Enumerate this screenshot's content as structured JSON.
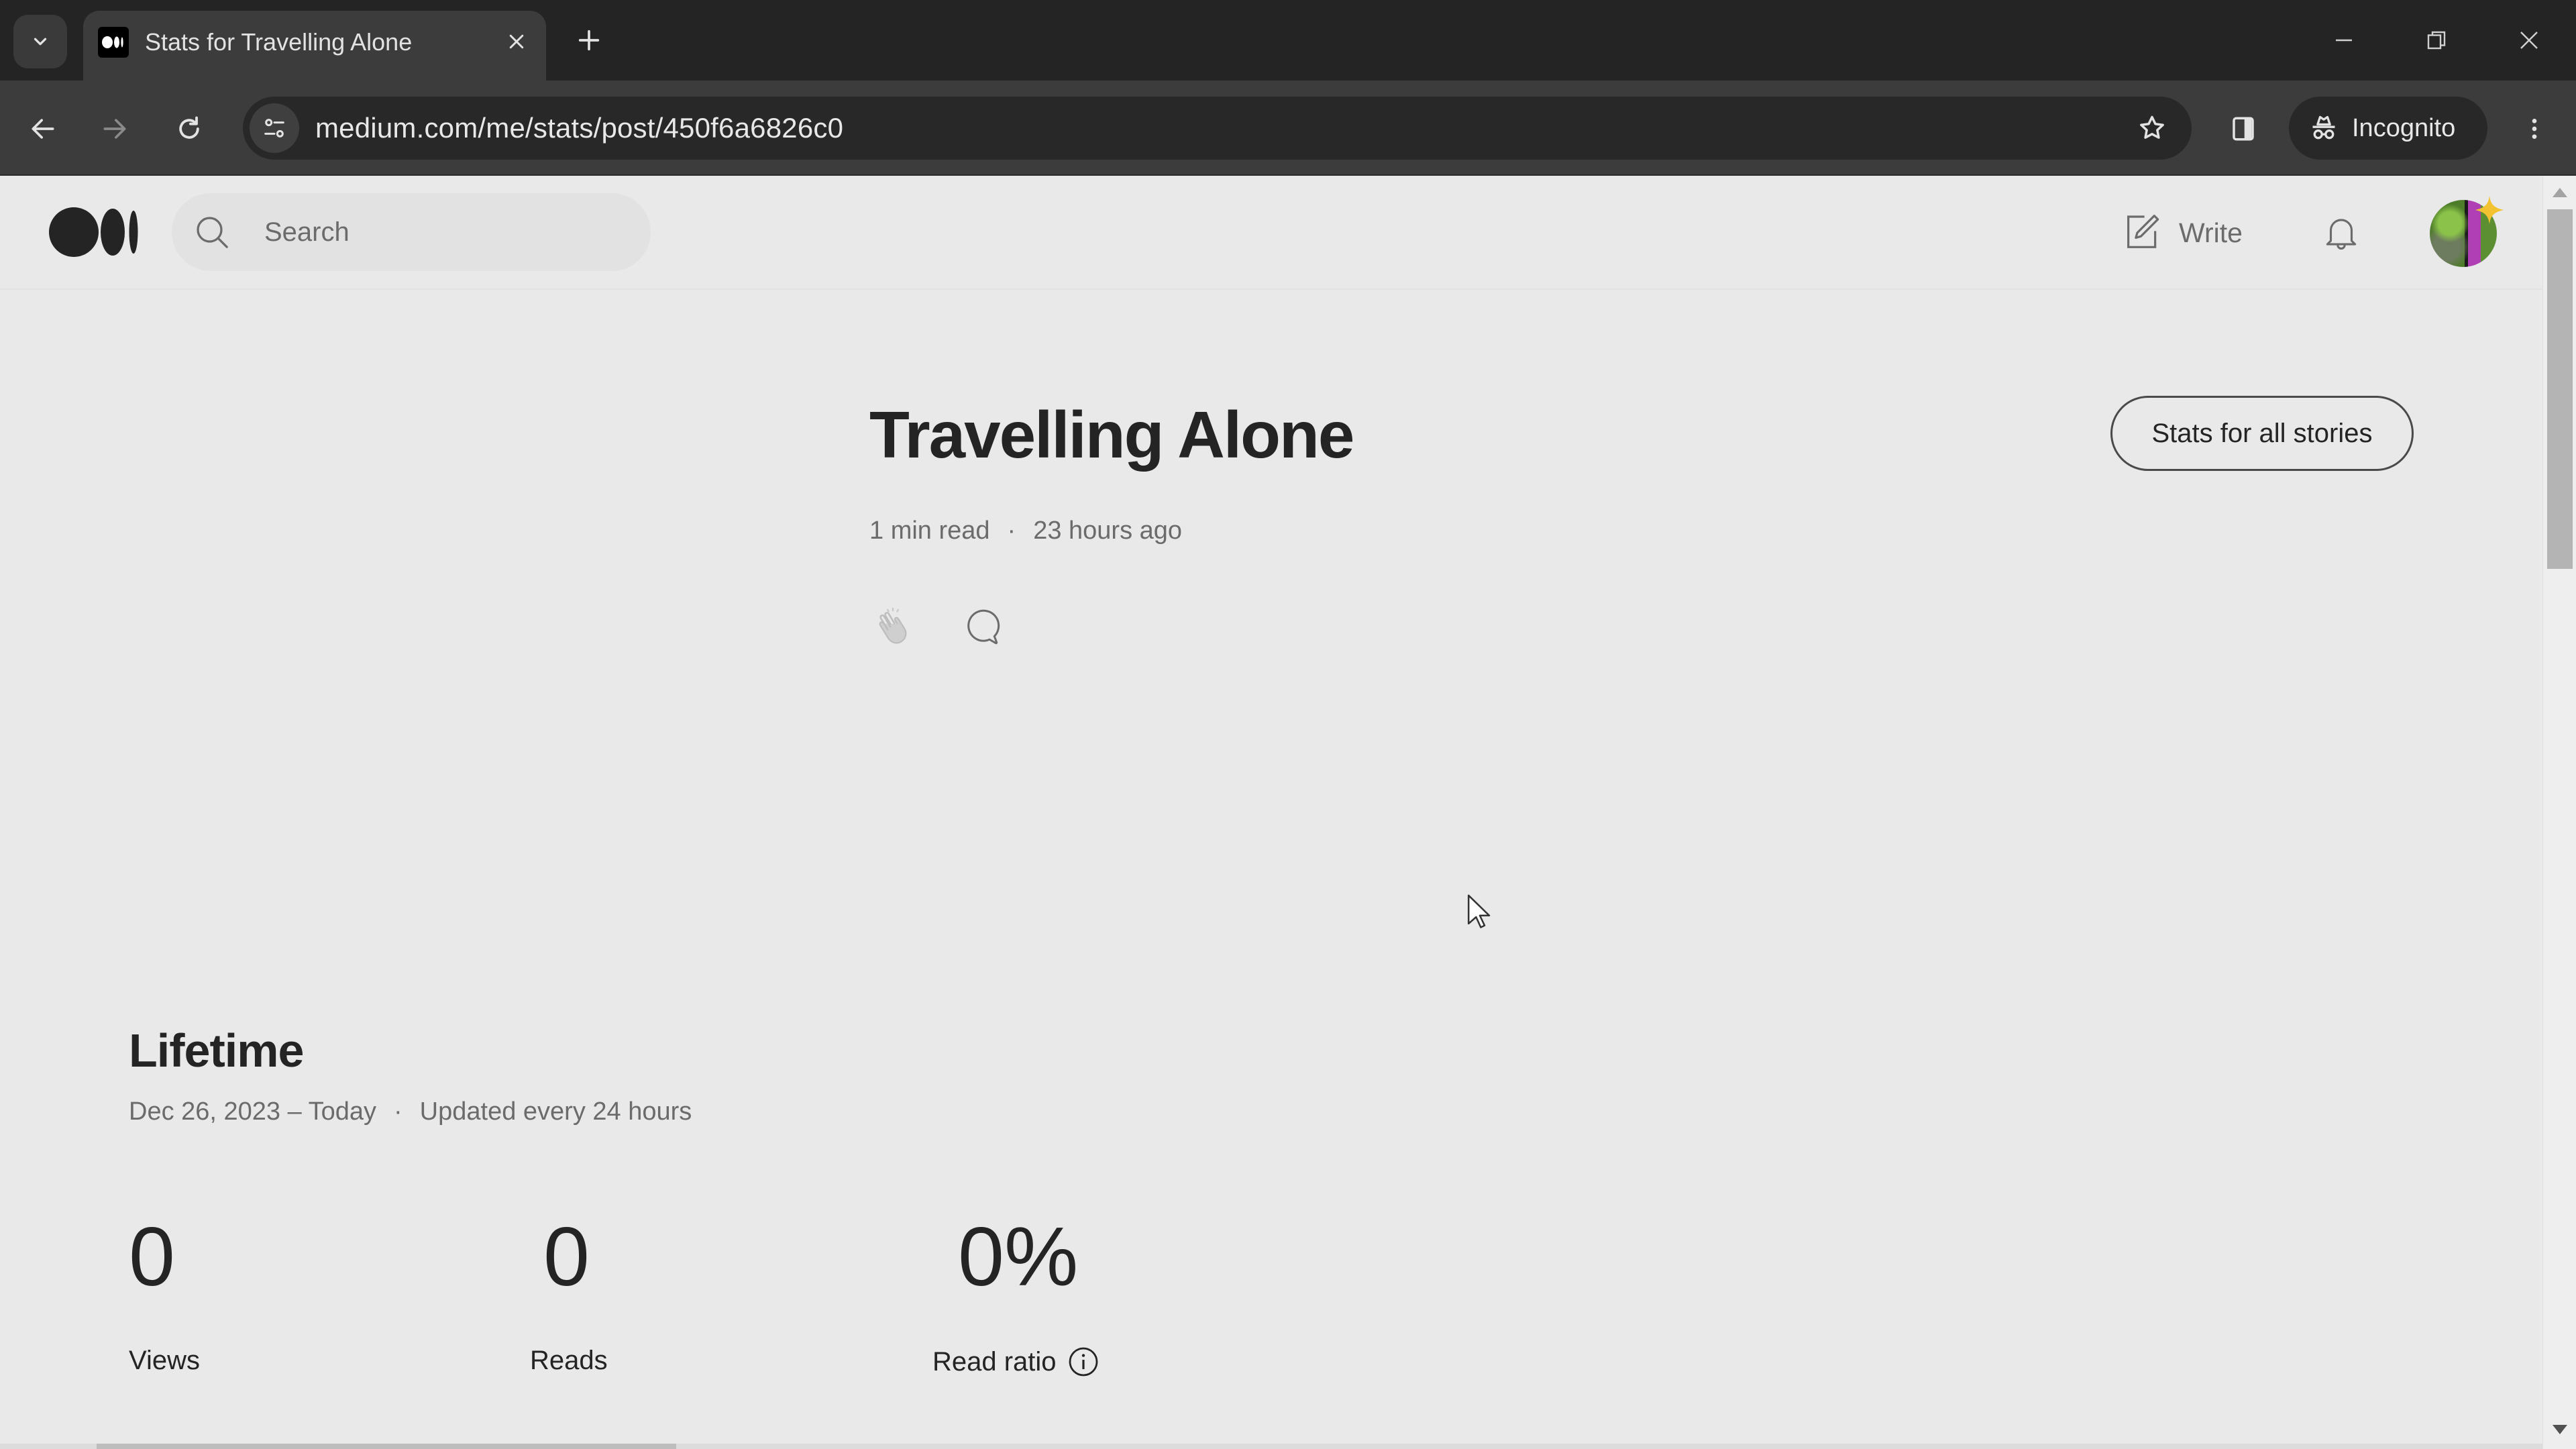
{
  "browser": {
    "tab": {
      "title": "Stats for Travelling Alone",
      "close_glyph": "✕",
      "favicon": "medium-logo-icon"
    },
    "new_tab_glyph": "+",
    "url": "medium.com/me/stats/post/450f6a6826c0",
    "incognito_label": "Incognito",
    "icons": [
      "tab-search-icon",
      "back-icon",
      "forward-icon",
      "reload-icon",
      "site-info-icon",
      "bookmark-star-icon",
      "side-panel-icon",
      "incognito-icon",
      "menu-icon",
      "minimize-icon",
      "restore-icon",
      "close-window-icon"
    ]
  },
  "header": {
    "logo": "medium-logo-icon",
    "search": {
      "placeholder": "Search",
      "value": ""
    },
    "write_label": "Write",
    "icons": [
      "search-icon",
      "write-icon",
      "bell-icon",
      "avatar"
    ]
  },
  "story": {
    "title": "Travelling Alone",
    "read_time": "1 min read",
    "separator": "·",
    "published": "23 hours ago",
    "icons": [
      "clap-icon",
      "comment-icon"
    ],
    "all_stories_button": "Stats for all stories"
  },
  "lifetime": {
    "title": "Lifetime",
    "date_range": "Dec 26, 2023 – Today",
    "separator": "·",
    "update_note": "Updated every 24 hours",
    "stats": [
      {
        "value": "0",
        "label": "Views"
      },
      {
        "value": "0",
        "label": "Reads"
      },
      {
        "value": "0%",
        "label": "Read ratio",
        "info_icon": "info-icon"
      }
    ]
  },
  "colors": {
    "page_bg": "#e9e9e9",
    "text_primary": "#242424",
    "text_secondary": "#6b6b6b",
    "chrome_dark": "#242424",
    "chrome_toolbar": "#3c3c3c",
    "avatar_star": "#f2c230"
  }
}
